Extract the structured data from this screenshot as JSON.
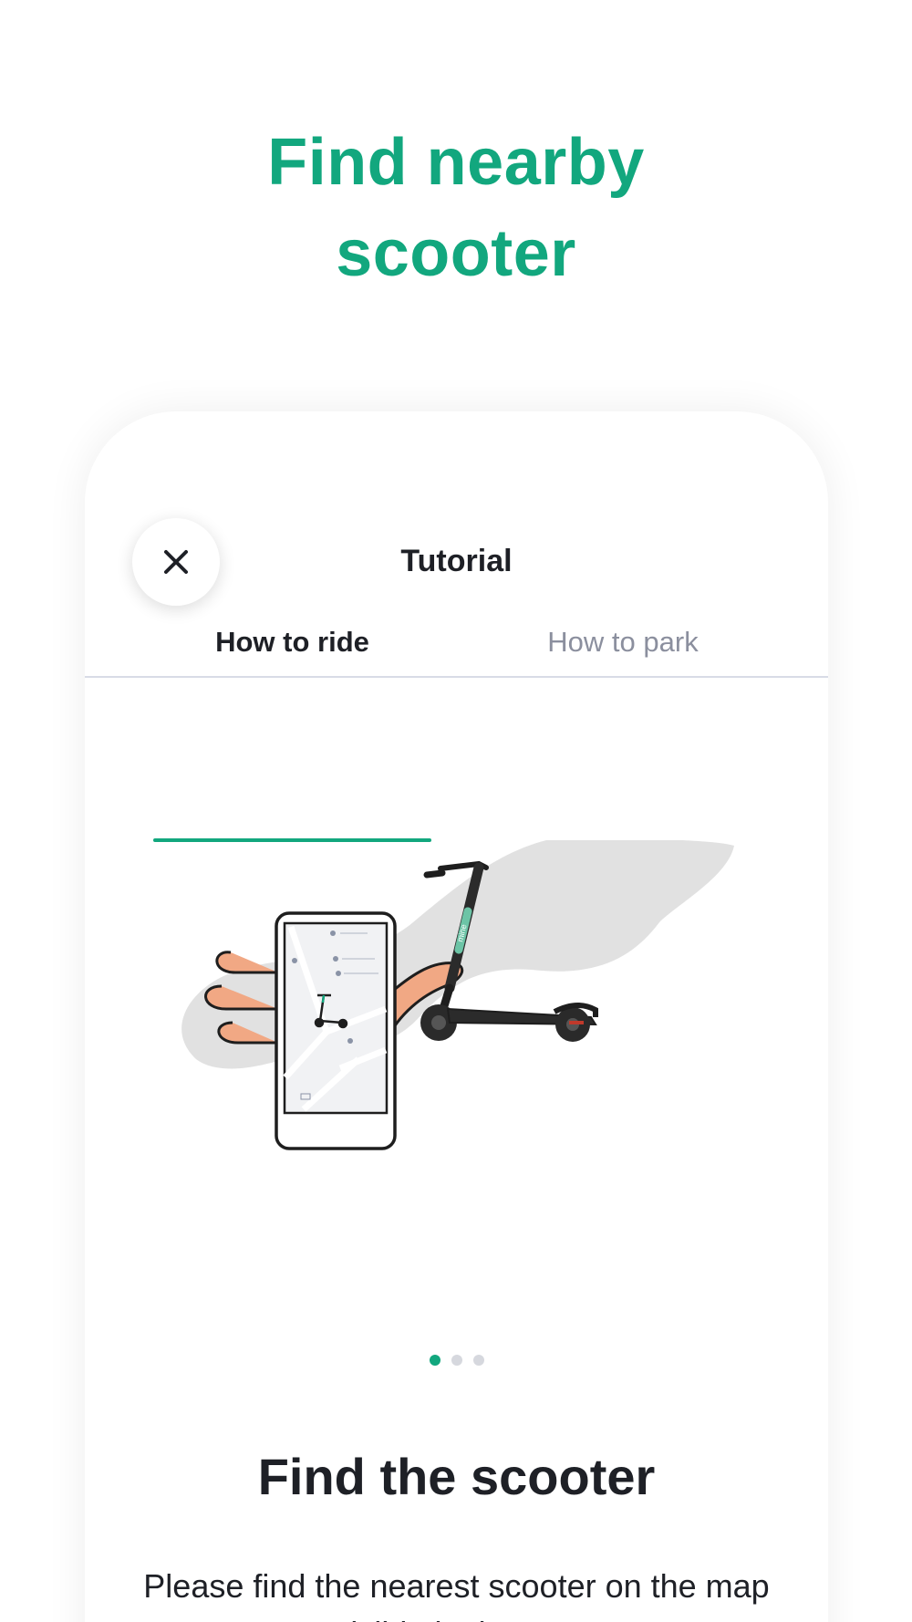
{
  "headline": {
    "line1": "Find nearby",
    "line2": "scooter"
  },
  "modal": {
    "title": "Tutorial",
    "close_icon": "close-icon"
  },
  "tabs": [
    {
      "label": "How to ride",
      "active": true
    },
    {
      "label": "How to park",
      "active": false
    }
  ],
  "illustration": {
    "icons": [
      "hand-holding-phone-icon",
      "map-icon",
      "scooter-icon"
    ],
    "scooter_brand": "mine"
  },
  "pager": {
    "count": 3,
    "active_index": 0
  },
  "step": {
    "title": "Find the scooter",
    "body": "Please find the nearest scooter on the map visible in the app"
  },
  "colors": {
    "accent": "#12a77e",
    "text_dark": "#1e2026",
    "text_muted": "#8b8f9e",
    "divider": "#d8dbe6",
    "blob": "#e1e1e1",
    "skin": "#f1a884"
  }
}
